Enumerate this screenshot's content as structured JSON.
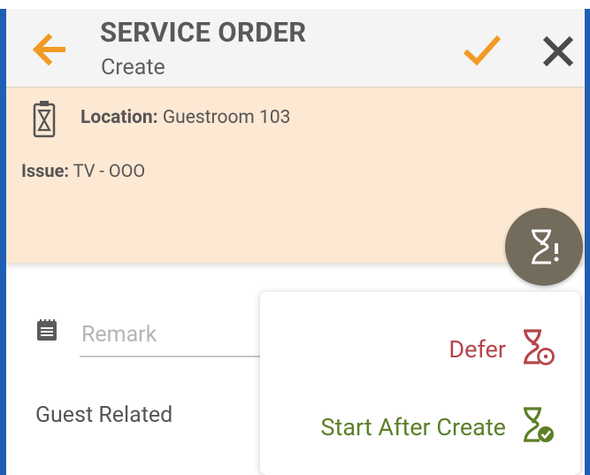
{
  "header": {
    "title": "SERVICE ORDER",
    "subtitle": "Create"
  },
  "info": {
    "location_label": "Location:",
    "location_value": "Guestroom 103",
    "issue_label": "Issue:",
    "issue_value": "TV - OOO"
  },
  "form": {
    "remark_placeholder": "Remark",
    "guest_related_label": "Guest Related"
  },
  "action_menu": {
    "items": [
      {
        "label": "Defer",
        "icon": "hourglass-clock-icon",
        "color": "#b5444b"
      },
      {
        "label": "Start After Create",
        "icon": "hourglass-check-icon",
        "color": "#5d7f28"
      }
    ]
  },
  "colors": {
    "accent": "#f29a26",
    "header_bg": "#f4f4f4",
    "info_bg": "#fde8d3",
    "fab_bg": "#736b5b",
    "frame": "#1e5fb5"
  }
}
